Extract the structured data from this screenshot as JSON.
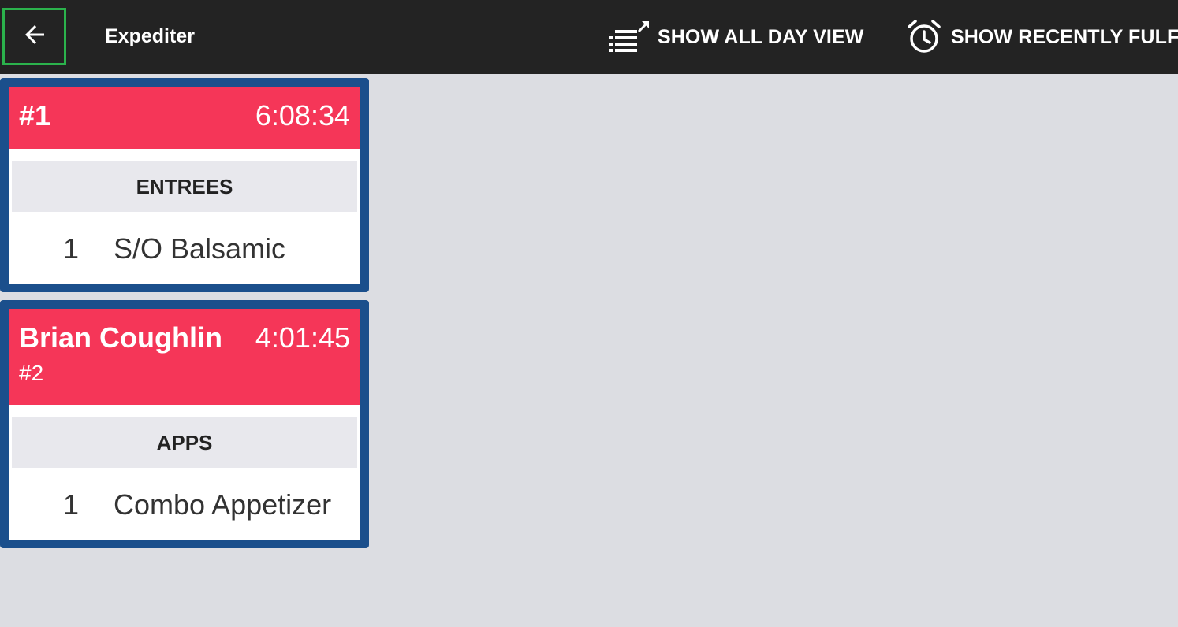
{
  "topbar": {
    "title": "Expediter",
    "back_icon": "arrow-left-icon",
    "actions": [
      {
        "label": "SHOW ALL DAY VIEW",
        "icon": "list-expand-icon"
      },
      {
        "label": "SHOW RECENTLY FULF",
        "icon": "alarm-clock-icon"
      }
    ]
  },
  "colors": {
    "topbar_bg": "#232323",
    "page_bg": "#dcdde2",
    "ticket_border": "#1b4f8c",
    "ticket_header": "#f53658",
    "section_bg": "#e8e8ed",
    "focus_outline": "#2bb24c"
  },
  "tickets": [
    {
      "name": "#1",
      "subtitle": "",
      "time": "6:08:34",
      "section": "ENTREES",
      "item": {
        "qty": "1",
        "name": "S/O Balsamic"
      }
    },
    {
      "name": "Brian Coughlin",
      "subtitle": "#2",
      "time": "4:01:45",
      "section": "APPS",
      "item": {
        "qty": "1",
        "name": "Combo Appetizer"
      }
    }
  ]
}
